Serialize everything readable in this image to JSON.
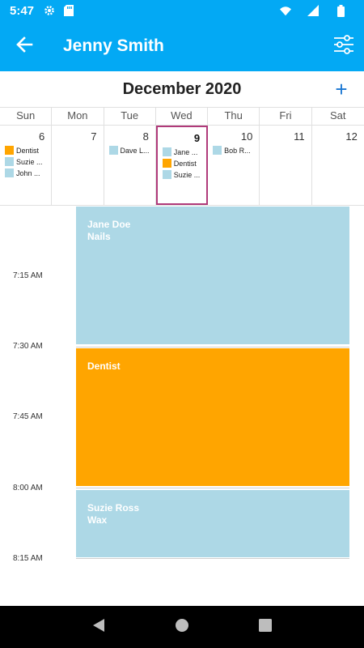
{
  "status_bar": {
    "time": "5:47",
    "icons": [
      "gear-icon",
      "sd-card-icon",
      "wifi-icon",
      "signal-icon",
      "battery-icon"
    ]
  },
  "app_bar": {
    "title": "Jenny Smith",
    "back_icon": "arrow-left-icon",
    "filter_icon": "sliders-icon"
  },
  "calendar": {
    "month_title": "December 2020",
    "add_label": "+",
    "weekdays": [
      "Sun",
      "Mon",
      "Tue",
      "Wed",
      "Thu",
      "Fri",
      "Sat"
    ],
    "days": [
      {
        "num": "6",
        "events": [
          {
            "label": "Dentist",
            "color": "#ffa500"
          },
          {
            "label": "Suzie ...",
            "color": "#add8e6"
          },
          {
            "label": "John ...",
            "color": "#add8e6"
          }
        ]
      },
      {
        "num": "7",
        "events": []
      },
      {
        "num": "8",
        "events": [
          {
            "label": "Dave L...",
            "color": "#add8e6"
          }
        ]
      },
      {
        "num": "9",
        "selected": true,
        "events": [
          {
            "label": "Jane ...",
            "color": "#add8e6"
          },
          {
            "label": "Dentist",
            "color": "#ffa500"
          },
          {
            "label": "Suzie ...",
            "color": "#add8e6"
          }
        ]
      },
      {
        "num": "10",
        "events": [
          {
            "label": "Bob R...",
            "color": "#add8e6"
          }
        ]
      },
      {
        "num": "11",
        "events": []
      },
      {
        "num": "12",
        "events": []
      }
    ]
  },
  "schedule": {
    "time_labels": [
      "7:15 AM",
      "7:30 AM",
      "7:45 AM",
      "8:00 AM",
      "8:15 AM"
    ],
    "events": [
      {
        "line1": "Jane Doe",
        "line2": "Nails",
        "color": "#add8e6"
      },
      {
        "line1": "Dentist",
        "line2": "",
        "color": "#ffa500"
      },
      {
        "line1": "Suzie Ross",
        "line2": "Wax",
        "color": "#add8e6"
      }
    ]
  },
  "nav_bar": {
    "icons": [
      "back-triangle-icon",
      "home-circle-icon",
      "recents-square-icon"
    ]
  },
  "colors": {
    "primary": "#03a9f4",
    "accent": "#1976d2",
    "selected_border": "#b03a7a",
    "event_blue": "#add8e6",
    "event_orange": "#ffa500"
  }
}
